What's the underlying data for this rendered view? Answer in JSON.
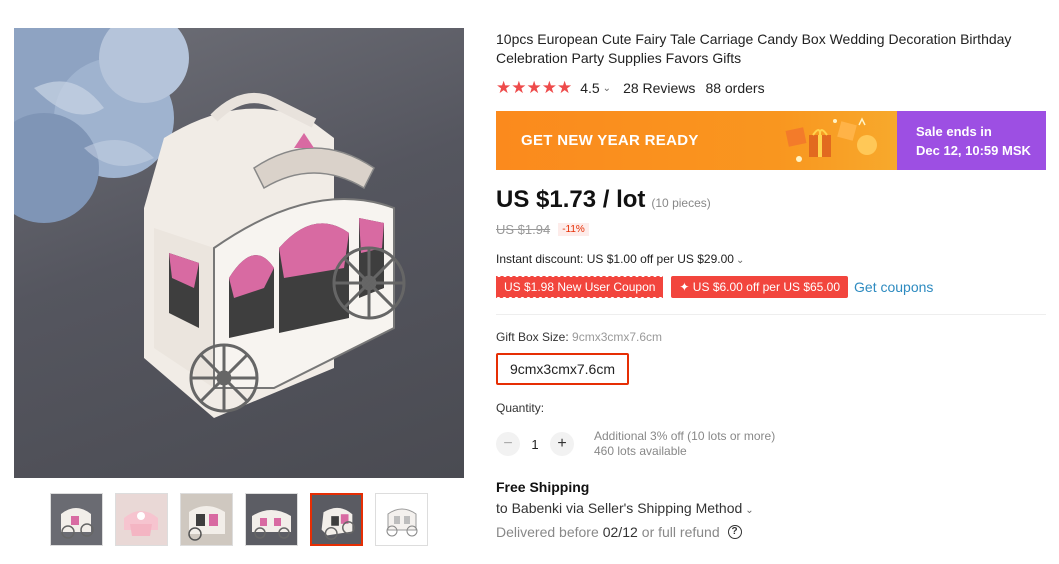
{
  "product": {
    "title": "10pcs European Cute Fairy Tale Carriage Candy Box Wedding Decoration Birthday Celebration Party Supplies Favors Gifts",
    "rating": "4.5",
    "stars": "★★★★★",
    "reviews": "28 Reviews",
    "orders": "88 orders"
  },
  "gallery": {
    "thumbnail_count": 6,
    "active_index": 4
  },
  "banner": {
    "promo": "GET NEW YEAR READY",
    "sale_line1": "Sale ends in",
    "sale_line2": "Dec 12, 10:59 MSK",
    "colors": {
      "promo_bg": "#fb8a1d",
      "sale_bg": "#9d4fe3"
    }
  },
  "price": {
    "current": "US $1.73 / lot",
    "pieces": "(10 pieces)",
    "original": "US $1.94",
    "discount": "-11%"
  },
  "instant_discount": "Instant discount: US $1.00 off per US $29.00",
  "coupons": {
    "new_user": "US $1.98 New User Coupon",
    "store": "✦ US $6.00 off per US $65.00",
    "get_link": "Get coupons"
  },
  "options": {
    "label": "Gift Box Size: ",
    "selected_value": "9cmx3cmx7.6cm",
    "button": "9cmx3cmx7.6cm"
  },
  "quantity": {
    "label": "Quantity:",
    "minus": "−",
    "value": "1",
    "plus": "+",
    "discount_note": "Additional 3% off (10 lots or more)",
    "available": "460 lots available"
  },
  "shipping": {
    "title": "Free Shipping",
    "to": "to Babenki via Seller's Shipping Method",
    "delivered_prefix": "Delivered before",
    "delivered_date": "02/12",
    "delivered_suffix": "or full refund",
    "help": "?"
  },
  "icons": {
    "dropdown": "chevron-down-icon",
    "help": "question-circle-icon"
  },
  "accent_color": "#e62e04"
}
